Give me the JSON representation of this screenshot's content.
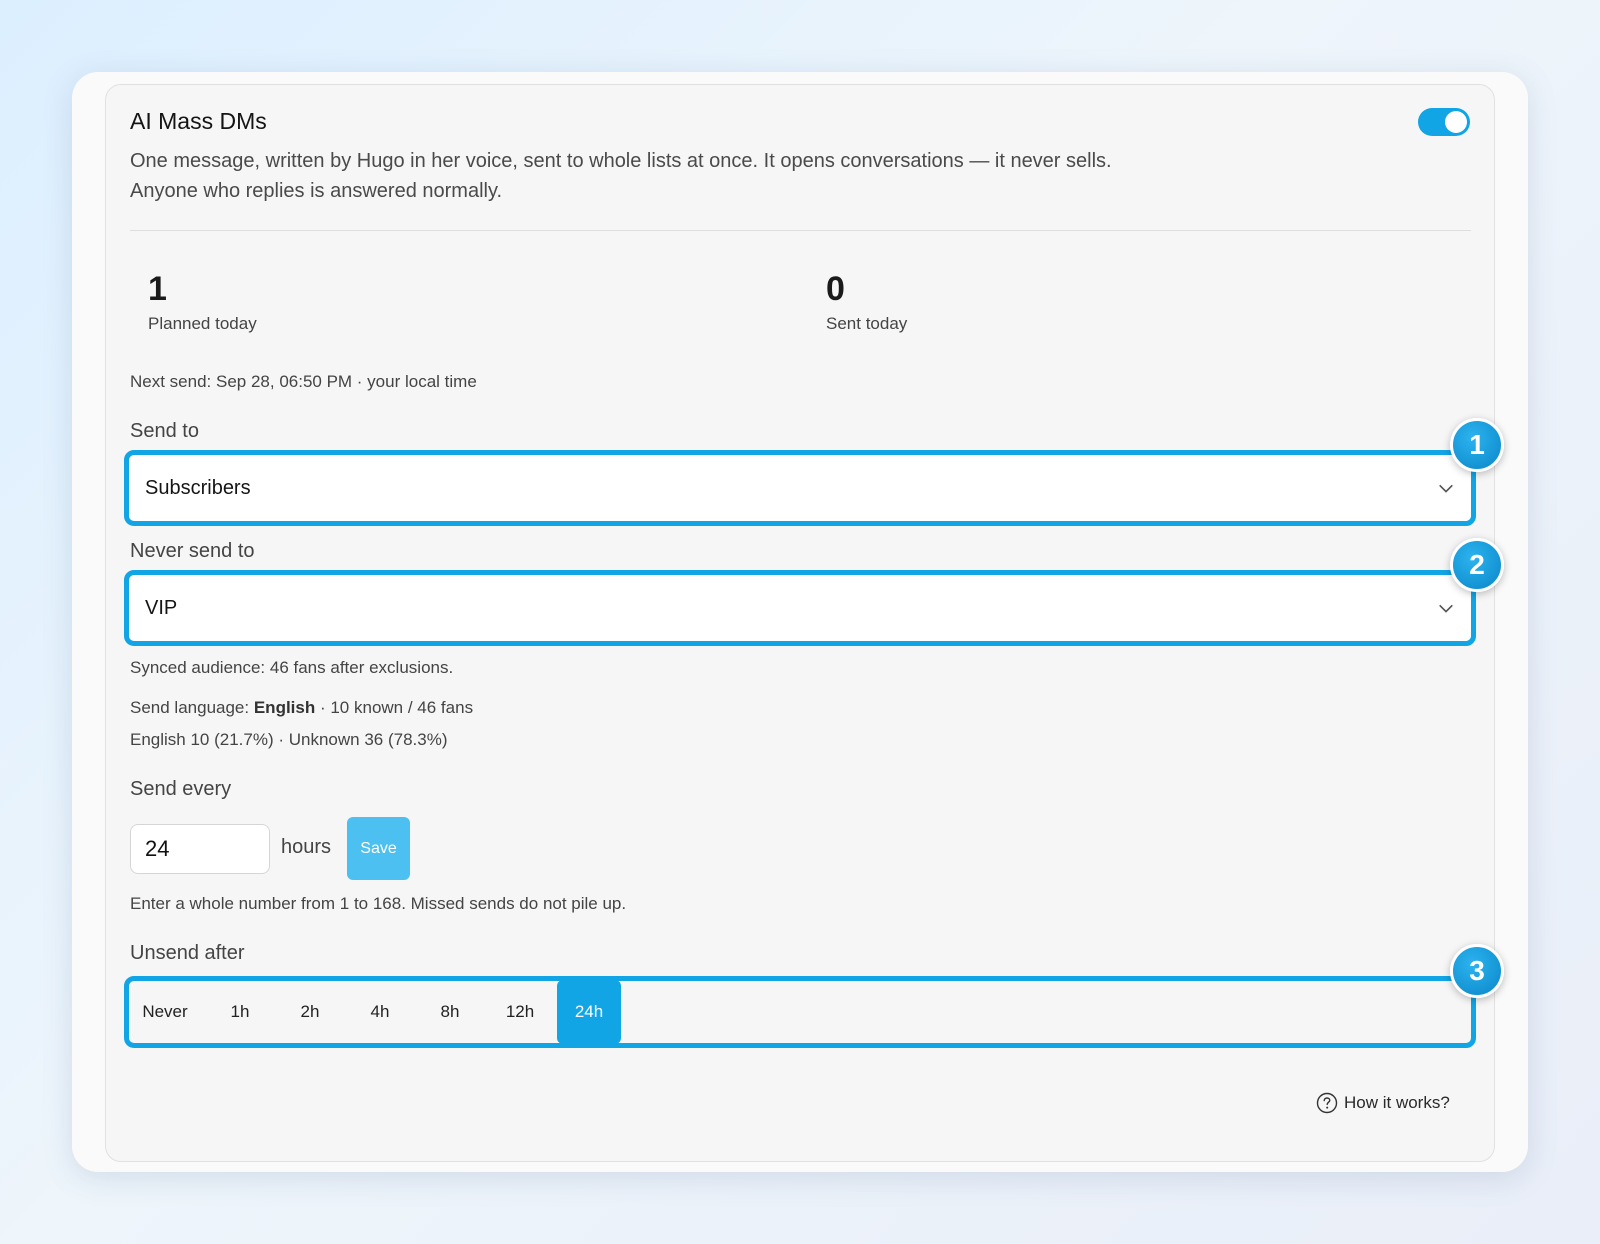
{
  "header": {
    "title": "AI Mass DMs",
    "description": "One message, written by Hugo in her voice, sent to whole lists at once. It opens conversations — it never sells. Anyone who replies is answered normally.",
    "enabled": true
  },
  "stats": {
    "planned": {
      "value": "1",
      "label": "Planned today"
    },
    "sent": {
      "value": "0",
      "label": "Sent today"
    }
  },
  "next_send": "Next send: Sep 28, 06:50 PM · your local time",
  "send_to": {
    "label": "Send to",
    "value": "Subscribers",
    "badge": "1"
  },
  "never_send_to": {
    "label": "Never send to",
    "value": "VIP",
    "badge": "2"
  },
  "audience": "Synced audience: 46 fans after exclusions.",
  "language": {
    "prefix": "Send language: ",
    "value": "English",
    "suffix": " · 10 known / 46 fans",
    "breakdown": "English 10 (21.7%) · Unknown 36 (78.3%)"
  },
  "send_every": {
    "label": "Send every",
    "value": "24",
    "unit": "hours",
    "save_label": "Save",
    "hint": "Enter a whole number from 1 to 168. Missed sends do not pile up."
  },
  "unsend_after": {
    "label": "Unsend after",
    "options": [
      "Never",
      "1h",
      "2h",
      "4h",
      "8h",
      "12h",
      "24h"
    ],
    "selected": "24h",
    "badge": "3"
  },
  "help": {
    "label": "How it works?"
  },
  "colors": {
    "accent": "#11a5e6",
    "save_button": "#4cc1f1"
  }
}
